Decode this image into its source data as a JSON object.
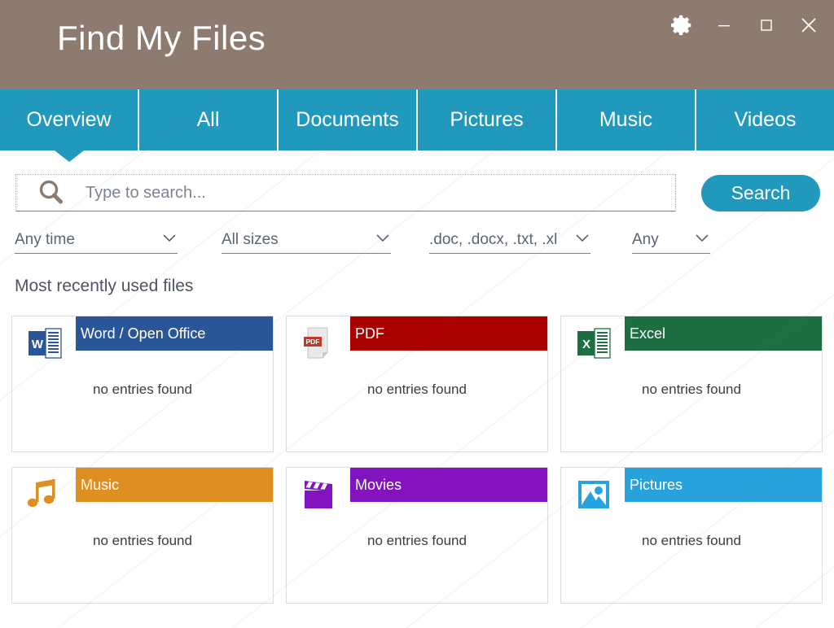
{
  "window": {
    "title": "Find My Files",
    "controls": [
      {
        "name": "settings-gear",
        "label": "Settings"
      },
      {
        "name": "minimize",
        "label": "Minimize"
      },
      {
        "name": "maximize",
        "label": "Maximize"
      },
      {
        "name": "close",
        "label": "Close"
      }
    ]
  },
  "tabs": [
    {
      "label": "Overview",
      "active": true
    },
    {
      "label": "All",
      "active": false
    },
    {
      "label": "Documents",
      "active": false
    },
    {
      "label": "Pictures",
      "active": false
    },
    {
      "label": "Music",
      "active": false
    },
    {
      "label": "Videos",
      "active": false
    }
  ],
  "search": {
    "value": "",
    "placeholder": "Type to search...",
    "icon": "magnifier-icon",
    "button_label": "Search"
  },
  "filters": [
    {
      "name": "time-filter",
      "value": "Any time",
      "icon": "chevron-down-icon"
    },
    {
      "name": "size-filter",
      "value": "All sizes",
      "icon": "chevron-down-icon"
    },
    {
      "name": "type-filter",
      "value": ".doc, .docx, .txt, .xl",
      "icon": "chevron-down-icon"
    },
    {
      "name": "extra-filter",
      "value": "Any",
      "icon": "chevron-down-icon"
    }
  ],
  "main": {
    "section_title": "Most recently used files",
    "cards": [
      {
        "title": "Word / Open Office",
        "empty_text": "no entries found",
        "color": "#2a5699",
        "icon": "word-icon"
      },
      {
        "title": "PDF",
        "empty_text": "no entries found",
        "color": "#aa0000",
        "icon": "pdf-icon"
      },
      {
        "title": "Excel",
        "empty_text": "no entries found",
        "color": "#1d6f42",
        "icon": "excel-icon"
      },
      {
        "title": "Music",
        "empty_text": "no entries found",
        "color": "#df8f20",
        "icon": "music-note-icon"
      },
      {
        "title": "Movies",
        "empty_text": "no entries found",
        "color": "#8312bf",
        "icon": "clapperboard-icon"
      },
      {
        "title": "Pictures",
        "empty_text": "no entries found",
        "color": "#28a2dc",
        "icon": "photo-icon"
      }
    ]
  },
  "colors": {
    "titlebar": "#8d7b70",
    "accent_teal": "#2199bd",
    "text_muted": "#5a6472"
  }
}
